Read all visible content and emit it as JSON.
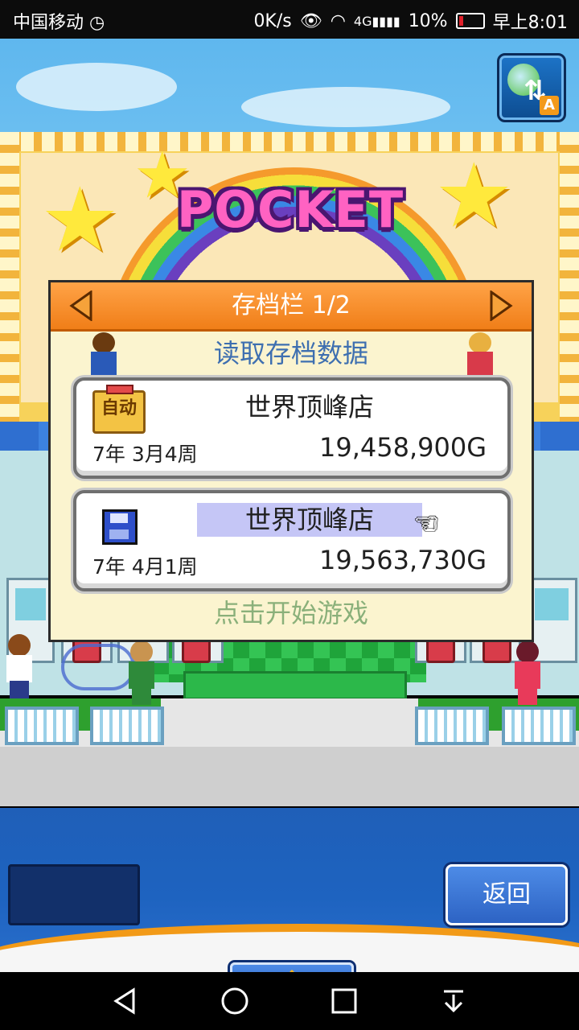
{
  "status_bar": {
    "carrier": "中国移动",
    "net_speed": "0K/s",
    "battery": "10%",
    "time": "早上8:01",
    "signal_label": "4G"
  },
  "game": {
    "logo_text": "POCKET",
    "switch_button_badge": "A",
    "auto_icon_label": "自动"
  },
  "dialog": {
    "title": "存档栏 1/2",
    "subtitle": "读取存档数据",
    "slots": [
      {
        "name": "世界顶峰店",
        "date": "7年 3月4周",
        "money": "19,458,900G",
        "type": "auto-save"
      },
      {
        "name": "世界顶峰店",
        "date": "7年 4月1周",
        "money": "19,563,730G",
        "type": "manual-save",
        "selected": true
      }
    ],
    "start_hint": "点击开始游戏"
  },
  "hud": {
    "back_label": "返回"
  },
  "colors": {
    "dialog_header": "#f07e18",
    "dialog_bg": "#fbf4cf",
    "subtitle": "#3e6fb0",
    "selected_highlight": "#c5c6f6",
    "hud_blue": "#1f5fb8"
  }
}
